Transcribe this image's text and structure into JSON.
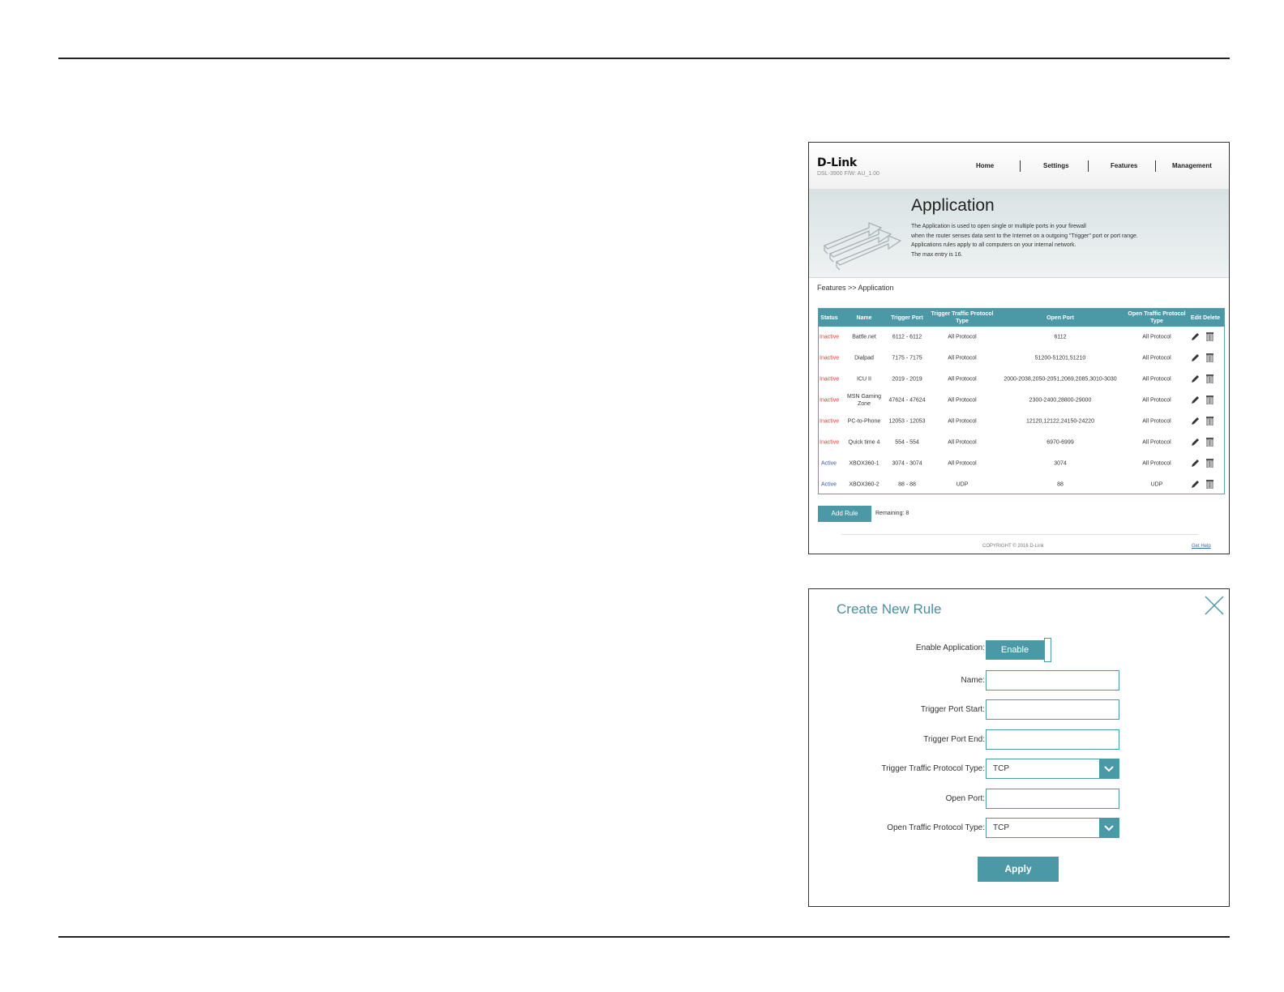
{
  "router": {
    "brand": "D-Link",
    "firmware": "DSL-3900   F/W: AU_1.00",
    "nav": [
      "Home",
      "Settings",
      "Features",
      "Management"
    ],
    "page_title": "Application",
    "description": [
      "The Application is used to open single or multiple ports in your firewall",
      "when the router senses data sent to the Internet on a outgoing \"Trigger\" port or port range.",
      "Applications rules apply to all computers on your internal network.",
      "The max entry is 16."
    ],
    "breadcrumb": "Features >> Application",
    "table": {
      "headers": {
        "status": "Status",
        "name": "Name",
        "trigger_port": "Trigger Port",
        "trigger_type": "Trigger Traffic Protocol Type",
        "open_port": "Open Port",
        "open_type": "Open Traffic Protocol Type",
        "edit_delete": "Edit Delete"
      },
      "rows": [
        {
          "status": "Inactive",
          "name": "Battle.net",
          "trigger_port": "6112 - 6112",
          "trigger_type": "All Protocol",
          "open_port": "6112",
          "open_type": "All Protocol"
        },
        {
          "status": "Inactive",
          "name": "Dialpad",
          "trigger_port": "7175 - 7175",
          "trigger_type": "All Protocol",
          "open_port": "51200-51201,51210",
          "open_type": "All Protocol"
        },
        {
          "status": "Inactive",
          "name": "ICU II",
          "trigger_port": "2019 - 2019",
          "trigger_type": "All Protocol",
          "open_port": "2000-2038,2050-2051,2069,2085,3010-3030",
          "open_type": "All Protocol"
        },
        {
          "status": "Inactive",
          "name": "MSN Gaming Zone",
          "trigger_port": "47624 - 47624",
          "trigger_type": "All Protocol",
          "open_port": "2300-2400,28800-29000",
          "open_type": "All Protocol"
        },
        {
          "status": "Inactive",
          "name": "PC-to-Phone",
          "trigger_port": "12053 - 12053",
          "trigger_type": "All Protocol",
          "open_port": "12120,12122,24150-24220",
          "open_type": "All Protocol"
        },
        {
          "status": "Inactive",
          "name": "Quick time 4",
          "trigger_port": "554 - 554",
          "trigger_type": "All Protocol",
          "open_port": "6970-6999",
          "open_type": "All Protocol"
        },
        {
          "status": "Active",
          "name": "XBOX360-1",
          "trigger_port": "3074 - 3074",
          "trigger_type": "All Protocol",
          "open_port": "3074",
          "open_type": "All Protocol"
        },
        {
          "status": "Active",
          "name": "XBOX360-2",
          "trigger_port": "88 - 88",
          "trigger_type": "UDP",
          "open_port": "88",
          "open_type": "UDP"
        }
      ]
    },
    "add_rule": "Add Rule",
    "remaining": "Remaining: 8",
    "copyright": "COPYRIGHT © 2016 D-Link",
    "get_help": "Get Help",
    "colors": {
      "accent": "#4b98a6",
      "inactive": "#e23b3b",
      "active": "#3a5aa8"
    }
  },
  "modal": {
    "title": "Create New Rule",
    "enable_label": "Enable Application:",
    "enable_value": "Enable",
    "name_label": "Name:",
    "trigger_start_label": "Trigger Port Start:",
    "trigger_end_label": "Trigger Port End:",
    "trigger_type_label": "Trigger Traffic Protocol Type:",
    "trigger_type_value": "TCP",
    "open_port_label": "Open Port:",
    "open_type_label": "Open Traffic Protocol Type:",
    "open_type_value": "TCP",
    "apply": "Apply"
  }
}
